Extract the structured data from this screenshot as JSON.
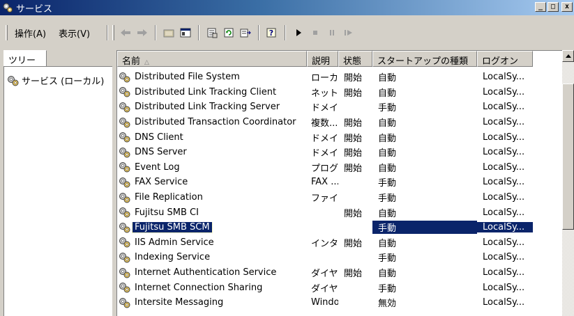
{
  "window": {
    "title": "サービス",
    "minimize": "_",
    "maximize": "□",
    "close": "x"
  },
  "menu": {
    "action": "操作(A)",
    "view": "表示(V)"
  },
  "toolbar": {
    "icons": [
      "back-icon",
      "forward-icon",
      "up-folder-icon",
      "show-hide-tree-icon",
      "properties-icon",
      "refresh-icon",
      "export-list-icon",
      "help-icon",
      "start-service-icon",
      "stop-service-icon",
      "pause-service-icon",
      "resume-service-icon"
    ]
  },
  "tree": {
    "tab_label": "ツリー",
    "root_label": "サービス (ローカル)"
  },
  "list": {
    "columns": {
      "name": "名前",
      "description": "説明",
      "state": "状態",
      "startup": "スタートアップの種類",
      "logon": "ログオン"
    },
    "rows": [
      {
        "name": "Distributed File System",
        "description": "ローカ...",
        "state": "開始",
        "startup": "自動",
        "logon": "LocalSy..."
      },
      {
        "name": "Distributed Link Tracking Client",
        "description": "ネット...",
        "state": "開始",
        "startup": "自動",
        "logon": "LocalSy..."
      },
      {
        "name": "Distributed Link Tracking Server",
        "description": "ドメイ...",
        "state": "",
        "startup": "手動",
        "logon": "LocalSy..."
      },
      {
        "name": "Distributed Transaction Coordinator",
        "description": "複数...",
        "state": "開始",
        "startup": "自動",
        "logon": "LocalSy..."
      },
      {
        "name": "DNS Client",
        "description": "ドメイ...",
        "state": "開始",
        "startup": "自動",
        "logon": "LocalSy..."
      },
      {
        "name": "DNS Server",
        "description": "ドメイ...",
        "state": "開始",
        "startup": "自動",
        "logon": "LocalSy..."
      },
      {
        "name": "Event Log",
        "description": "プログ...",
        "state": "開始",
        "startup": "自動",
        "logon": "LocalSy..."
      },
      {
        "name": "FAX Service",
        "description": "FAX ...",
        "state": "",
        "startup": "手動",
        "logon": "LocalSy..."
      },
      {
        "name": "File Replication",
        "description": "ファイ...",
        "state": "",
        "startup": "手動",
        "logon": "LocalSy..."
      },
      {
        "name": "Fujitsu SMB CI",
        "description": "",
        "state": "開始",
        "startup": "自動",
        "logon": "LocalSy..."
      },
      {
        "name": "Fujitsu SMB SCM",
        "description": "",
        "state": "",
        "startup": "手動",
        "logon": "LocalSy...",
        "selected": true
      },
      {
        "name": "IIS Admin Service",
        "description": "インタ...",
        "state": "開始",
        "startup": "自動",
        "logon": "LocalSy..."
      },
      {
        "name": "Indexing Service",
        "description": "",
        "state": "",
        "startup": "手動",
        "logon": "LocalSy..."
      },
      {
        "name": "Internet Authentication Service",
        "description": "ダイヤ...",
        "state": "開始",
        "startup": "自動",
        "logon": "LocalSy..."
      },
      {
        "name": "Internet Connection Sharing",
        "description": "ダイヤ...",
        "state": "",
        "startup": "手動",
        "logon": "LocalSy..."
      },
      {
        "name": "Intersite Messaging",
        "description": "Windo...",
        "state": "",
        "startup": "無効",
        "logon": "LocalSy..."
      }
    ]
  },
  "colors": {
    "titlebar_start": "#0a246a",
    "titlebar_end": "#a6caf0",
    "selection": "#0a246a",
    "face": "#d4d0c8"
  }
}
